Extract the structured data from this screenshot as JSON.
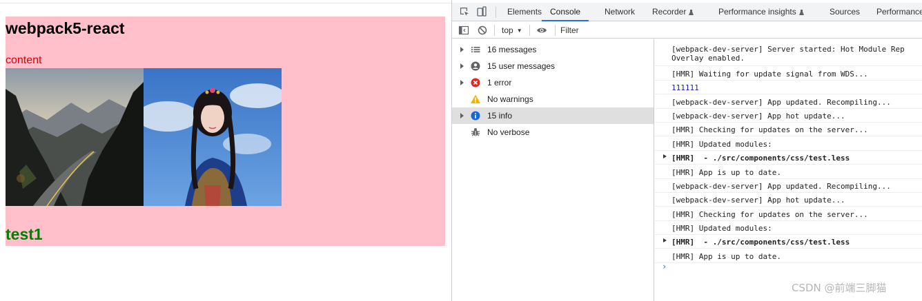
{
  "page": {
    "heading": "webpack5-react",
    "content_text": "content",
    "subheading": "test1",
    "colors": {
      "background": "#ffc0cb",
      "content_text": "#e00000",
      "subheading": "#008000"
    }
  },
  "devtools": {
    "tabs": [
      {
        "label": "Elements"
      },
      {
        "label": "Console",
        "active": true
      },
      {
        "label": "Network"
      },
      {
        "label": "Recorder",
        "icon": "flask-icon"
      },
      {
        "label": "Performance insights",
        "icon": "flask-icon"
      },
      {
        "label": "Sources"
      },
      {
        "label": "Performance"
      }
    ],
    "toolbar": {
      "context": "top",
      "filter_placeholder": "Filter"
    },
    "sidebar": [
      {
        "label": "16 messages",
        "icon": "list-icon",
        "expandable": true
      },
      {
        "label": "15 user messages",
        "icon": "user-icon",
        "expandable": true
      },
      {
        "label": "1 error",
        "icon": "error-icon",
        "expandable": true
      },
      {
        "label": "No warnings",
        "icon": "warning-icon",
        "expandable": false
      },
      {
        "label": "15 info",
        "icon": "info-icon",
        "expandable": true,
        "selected": true
      },
      {
        "label": "No verbose",
        "icon": "bug-icon",
        "expandable": false
      }
    ],
    "console_messages": [
      {
        "text": "[webpack-dev-server] Server started: Hot Module Rep\nOverlay enabled."
      },
      {
        "text": "[HMR] Waiting for update signal from WDS..."
      },
      {
        "text": "111111",
        "style": "blue"
      },
      {
        "text": "[webpack-dev-server] App updated. Recompiling..."
      },
      {
        "text": "[webpack-dev-server] App hot update..."
      },
      {
        "text": "[HMR] Checking for updates on the server..."
      },
      {
        "text": "[HMR] Updated modules:"
      },
      {
        "text": "[HMR]  - ./src/components/css/test.less",
        "style": "bold",
        "expandable": true
      },
      {
        "text": "[HMR] App is up to date."
      },
      {
        "text": "[webpack-dev-server] App updated. Recompiling..."
      },
      {
        "text": "[webpack-dev-server] App hot update..."
      },
      {
        "text": "[HMR] Checking for updates on the server..."
      },
      {
        "text": "[HMR] Updated modules:"
      },
      {
        "text": "[HMR]  - ./src/components/css/test.less",
        "style": "bold",
        "expandable": true
      },
      {
        "text": "[HMR] App is up to date."
      }
    ],
    "watermark": "CSDN @前端三脚猫"
  }
}
